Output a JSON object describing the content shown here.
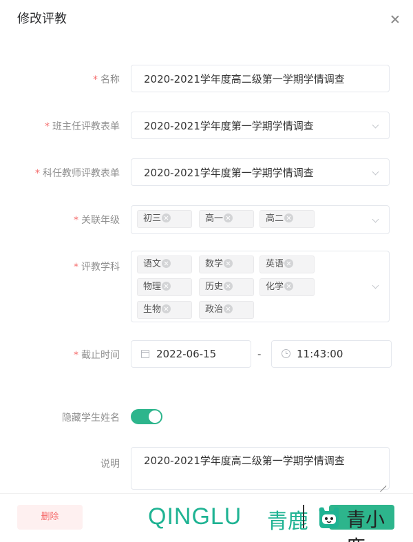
{
  "dialog": {
    "title": "修改评教"
  },
  "form": {
    "name": {
      "label": "名称",
      "value": "2020-2021学年度高二级第一学期学情调查"
    },
    "head_teacher_form": {
      "label": "班主任评教表单",
      "value": "2020-2021学年度第一学期学情调查"
    },
    "subject_teacher_form": {
      "label": "科任教师评教表单",
      "value": "2020-2021学年度第一学期学情调查"
    },
    "grades": {
      "label": "关联年级",
      "tags": [
        "初三",
        "高一",
        "高二"
      ]
    },
    "subjects": {
      "label": "评教学科",
      "tags": [
        "语文",
        "数学",
        "英语",
        "物理",
        "历史",
        "化学",
        "生物",
        "政治"
      ]
    },
    "deadline": {
      "label": "截止时间",
      "date": "2022-06-15",
      "separator": "-",
      "time": "11:43:00"
    },
    "hide_name": {
      "label": "隐藏学生姓名",
      "enabled": true
    },
    "description": {
      "label": "说明",
      "value": "2020-2021学年度高二级第一学期学情调查"
    },
    "required_mark": "*"
  },
  "footer": {
    "delete_label": "删除"
  },
  "watermark": {
    "brand_en": "QINGLU",
    "brand_cn": "青鹿",
    "product_cn": "青小鹿"
  },
  "colors": {
    "accent": "#2db58c",
    "danger": "#f56c6c",
    "watermark": "#1fb393"
  }
}
